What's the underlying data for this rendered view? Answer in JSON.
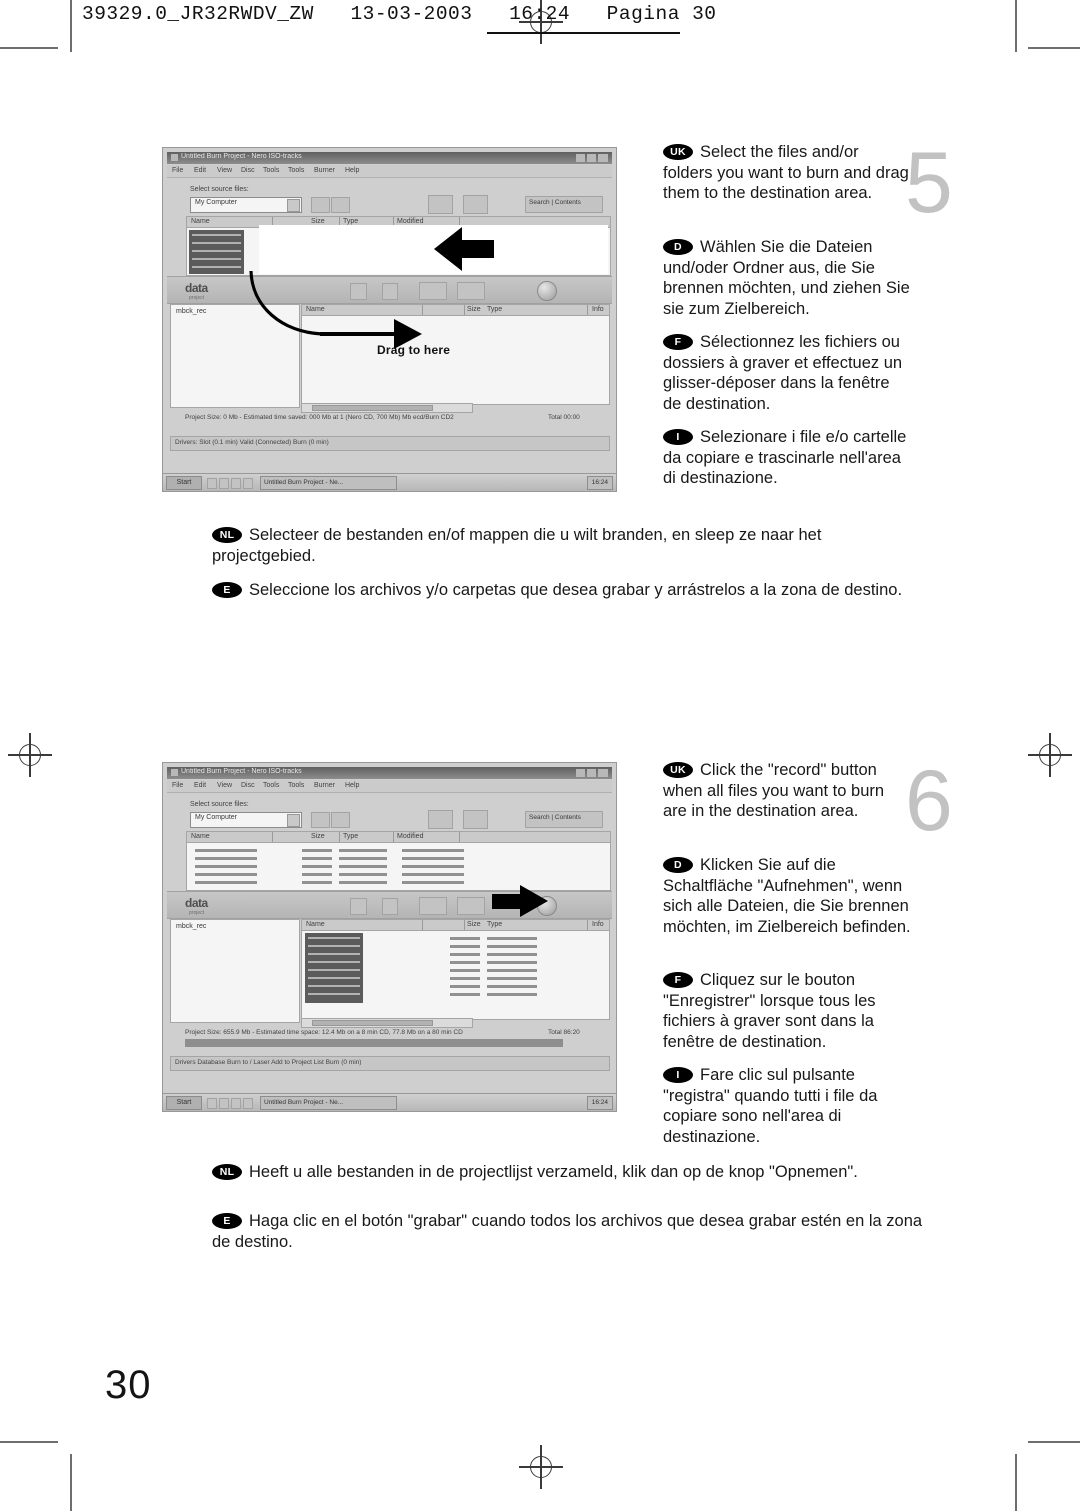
{
  "page": {
    "slug": "39329.0_JR32RWDV_ZW   13-03-2003   16:24   Pagina 30",
    "page_number": "30"
  },
  "steps": [
    {
      "number": "5",
      "narrow_paragraphs": [
        {
          "flag": "UK",
          "text": "Select the files and/or folders you want to burn and drag them to the destination area."
        },
        {
          "flag": "D",
          "text": "Wählen Sie die Dateien und/oder Ordner aus, die Sie brennen möchten, und ziehen Sie sie zum Zielbereich."
        },
        {
          "flag": "F",
          "text": "Sélectionnez les fichiers ou dossiers à graver et effectuez un glisser-déposer dans la fenêtre de destination."
        },
        {
          "flag": "I",
          "text": "Selezionare i file e/o cartelle da copiare e trascinarle nell'area di destinazione."
        }
      ],
      "wide_paragraphs": [
        {
          "flag": "NL",
          "text": "Selecteer de bestanden en/of mappen die u wilt branden, en sleep ze naar het projectgebied."
        },
        {
          "flag": "E",
          "text": "Seleccione los archivos y/o carpetas que desea grabar y arrástrelos a la zona de destino."
        }
      ],
      "screenshot": {
        "window_title": "Untitled Burn Project - Nero ISO-tracks",
        "menus": [
          "File",
          "Edit",
          "View",
          "Disc",
          "Tools",
          "Tools",
          "Burner",
          "Help"
        ],
        "source_label": "Select source files:",
        "combo_value": "My Computer",
        "search_button": "Search | Contents",
        "columns": [
          "Name",
          "Size",
          "Type",
          "Modified"
        ],
        "tree_node": "mbck_rec",
        "dest_columns": [
          "Name",
          "Size",
          "Type",
          "Info"
        ],
        "status_text": "Project Size: 0 Mb - Estimated time saved: 000 Mb at 1 (Nero CD, 700 Mb) Mb ecd/Burn CD2",
        "status_right": "Total        00:00",
        "toolbar_text": "Drivers:  Slot (0.1 min)  Valid (Connected)  Burn (0 min)",
        "taskbar_item": "Untitled Burn Project - Ne...",
        "taskbar_start": "Start",
        "taskbar_clock": "16:24",
        "annotation_label": "Drag to here",
        "brand_word": "data",
        "brand_sub": "project"
      }
    },
    {
      "number": "6",
      "narrow_paragraphs": [
        {
          "flag": "UK",
          "text": "Click the \"record\" button when all files you want to burn are in the destination area."
        },
        {
          "flag": "D",
          "text": "Klicken Sie auf die Schaltfläche \"Aufnehmen\", wenn sich alle Dateien, die Sie brennen möchten, im Zielbereich befinden."
        },
        {
          "flag": "F",
          "text": "Cliquez sur le bouton \"Enregistrer\" lorsque tous les fichiers à graver sont dans la fenêtre de destination."
        },
        {
          "flag": "I",
          "text": "Fare clic sul pulsante \"registra\" quando tutti i file da copiare sono nell'area di destinazione."
        }
      ],
      "wide_paragraphs": [
        {
          "flag": "NL",
          "text": "Heeft u alle bestanden in de projectlijst verzameld, klik dan op de knop \"Opnemen\"."
        },
        {
          "flag": "E",
          "text": "Haga clic en el botón \"grabar\" cuando todos los archivos que desea grabar estén en la zona de destino."
        }
      ],
      "screenshot": {
        "window_title": "Untitled Burn Project - Nero ISO-tracks",
        "menus": [
          "File",
          "Edit",
          "View",
          "Disc",
          "Tools",
          "Tools",
          "Burner",
          "Help"
        ],
        "source_label": "Select source files:",
        "combo_value": "My Computer",
        "search_button": "Search | Contents",
        "columns": [
          "Name",
          "Size",
          "Type",
          "Modified"
        ],
        "tree_node": "mbck_rec",
        "dest_columns": [
          "Name",
          "Size",
          "Type",
          "Info"
        ],
        "status_text": "Project Size: 655.9 Mb - Estimated time space: 12.4 Mb on a 8 min CD, 77.8 Mb on a 80 min CD",
        "status_right": "Total        86:20",
        "toolbar_text": "Drivers  Database  Burn to / Laser  Add to Project List  Burn (0 min)",
        "taskbar_item": "Untitled Burn Project - Ne...",
        "taskbar_start": "Start",
        "taskbar_clock": "16:24",
        "record_button_label": "Record",
        "brand_word": "data",
        "brand_sub": "project"
      }
    }
  ]
}
